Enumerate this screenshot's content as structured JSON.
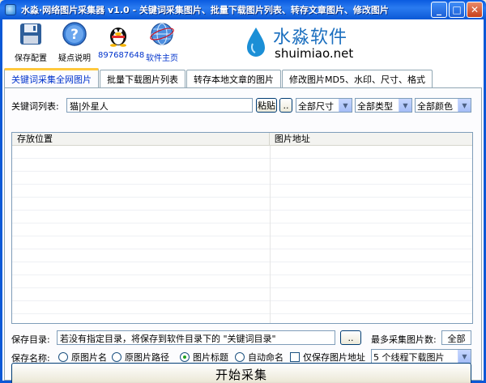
{
  "window": {
    "title": "水淼·网络图片采集器 v1.0 - 关键词采集图片、批量下载图片列表、转存文章图片、修改图片",
    "minimize": "_",
    "maximize": "□",
    "close": "✕"
  },
  "toolbar": {
    "items": [
      {
        "label": "保存配置",
        "icon": "floppy-disk-icon"
      },
      {
        "label": "疑点说明",
        "icon": "help-icon"
      },
      {
        "label": "897687648",
        "icon": "qq-penguin-icon"
      },
      {
        "label": "软件主页",
        "icon": "globe-icon"
      }
    ]
  },
  "logo": {
    "cn": "水淼软件",
    "en": "shuimiao.net"
  },
  "tabs": [
    {
      "label": "关键词采集全网图片",
      "active": true
    },
    {
      "label": "批量下载图片列表",
      "active": false
    },
    {
      "label": "转存本地文章的图片",
      "active": false
    },
    {
      "label": "修改图片MD5、水印、尺寸、格式",
      "active": false
    }
  ],
  "keyword": {
    "label": "关键词列表:",
    "value": "猫|外星人",
    "paste_button": "粘贴",
    "browse_button": "..",
    "size_select": "全部尺寸",
    "type_select": "全部类型",
    "color_select": "全部颜色"
  },
  "table": {
    "columns": [
      "存放位置",
      "图片地址"
    ]
  },
  "save_dir": {
    "label": "保存目录:",
    "value": "若没有指定目录，将保存到软件目录下的 \"关键词目录\"",
    "browse_button": "..",
    "max_label": "最多采集图片数:",
    "max_value": "全部"
  },
  "save_name": {
    "label": "保存名称:",
    "options": [
      {
        "label": "原图片名",
        "checked": false
      },
      {
        "label": "原图片路径",
        "checked": false
      },
      {
        "label": "图片标题",
        "checked": true
      },
      {
        "label": "自动命名",
        "checked": false
      }
    ],
    "only_address_label": "仅保存图片地址",
    "threads_select": "5 个线程下载图片"
  },
  "start_button": "开始采集",
  "colors": {
    "title_bar": "#0b58d6",
    "active_tab_text": "#0033cc",
    "tab_highlight": "#ffc83c",
    "logo_text": "#1b6fbf"
  }
}
